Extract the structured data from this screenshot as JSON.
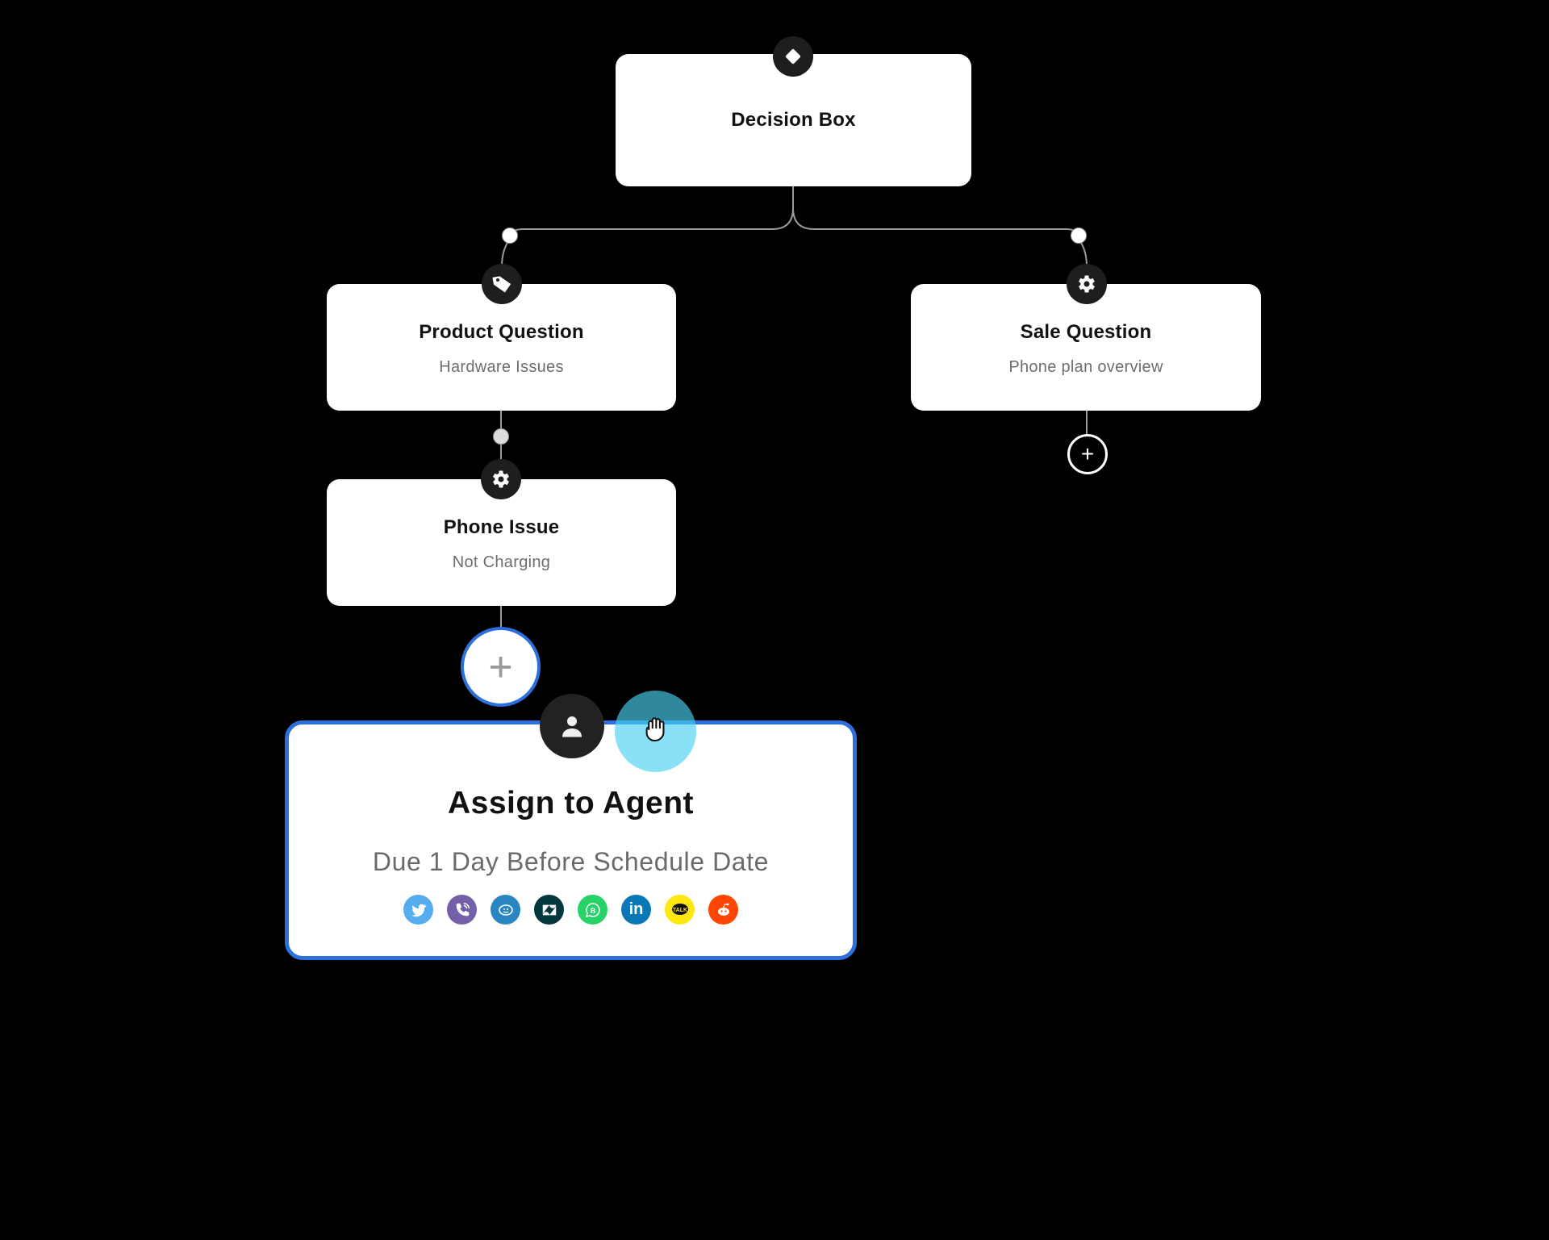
{
  "canvas": {
    "background": "#000000",
    "connector_color": "#9a9a9a",
    "selected_color": "#2d6fdd"
  },
  "nodes": {
    "decision": {
      "title": "Decision Box",
      "icon": "diamond-icon"
    },
    "product_question": {
      "title": "Product Question",
      "subtitle": "Hardware Issues",
      "icon": "tag-icon"
    },
    "sale_question": {
      "title": "Sale Question",
      "subtitle": "Phone plan overview",
      "icon": "gear-icon"
    },
    "phone_issue": {
      "title": "Phone Issue",
      "subtitle": "Not Charging",
      "icon": "gear-icon"
    },
    "assign_agent": {
      "title": "Assign to Agent",
      "subtitle": "Due 1 Day Before Schedule Date",
      "icon": "user-icon",
      "selected": true,
      "channels": [
        {
          "name": "twitter",
          "color": "#55acee"
        },
        {
          "name": "viber",
          "color": "#7360a8"
        },
        {
          "name": "chat-messenger",
          "color": "#2a86c0"
        },
        {
          "name": "zendesk",
          "color": "#03363d"
        },
        {
          "name": "whatsapp-business",
          "color": "#25d366"
        },
        {
          "name": "linkedin",
          "color": "#0a78b5"
        },
        {
          "name": "kakaotalk",
          "color": "#ffe812"
        },
        {
          "name": "reddit",
          "color": "#ff4500"
        }
      ]
    }
  },
  "add_buttons": {
    "symbol": "+"
  },
  "cursor": {
    "type": "grab-hand-icon",
    "highlight_color": "#48d1f0"
  }
}
